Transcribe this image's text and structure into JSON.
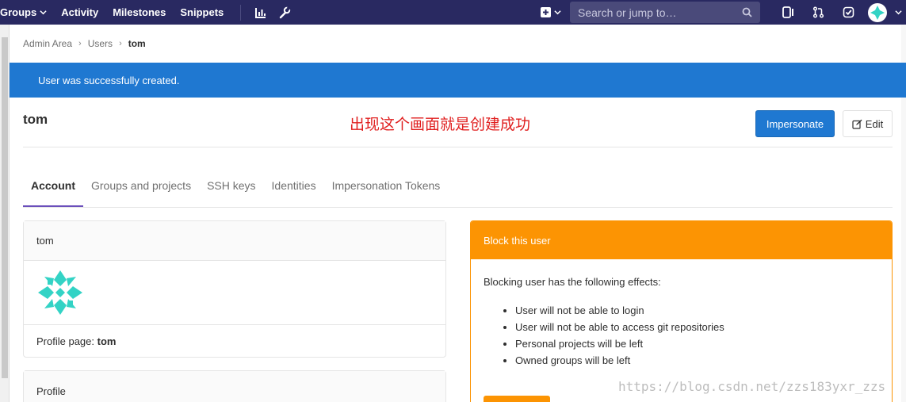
{
  "nav": {
    "groups": "Groups",
    "activity": "Activity",
    "milestones": "Milestones",
    "snippets": "Snippets",
    "search_placeholder": "Search or jump to…"
  },
  "breadcrumbs": [
    "Admin Area",
    "Users",
    "tom"
  ],
  "flash": "User was successfully created.",
  "page": {
    "title": "tom",
    "annotation": "出现这个画面就是创建成功",
    "impersonate": "Impersonate",
    "edit": "Edit"
  },
  "tabs": [
    "Account",
    "Groups and projects",
    "SSH keys",
    "Identities",
    "Impersonation Tokens"
  ],
  "account_card": {
    "username": "tom",
    "profile_label": "Profile page:",
    "profile_value": "tom"
  },
  "profile_card": {
    "title": "Profile"
  },
  "block": {
    "title": "Block this user",
    "intro": "Blocking user has the following effects:",
    "effects": [
      "User will not be able to login",
      "User will not be able to access git repositories",
      "Personal projects will be left",
      "Owned groups will be left"
    ]
  },
  "watermark": "https://blog.csdn.net/zzs183yxr_zzs",
  "colors": {
    "navbar": "#292961",
    "flash": "#1f78d1",
    "primary_button": "#1f78d1",
    "block_warning": "#fc9403",
    "annotation": "#e02020",
    "tab_active": "#6b4fbb",
    "identicon": "#33d3c5"
  }
}
